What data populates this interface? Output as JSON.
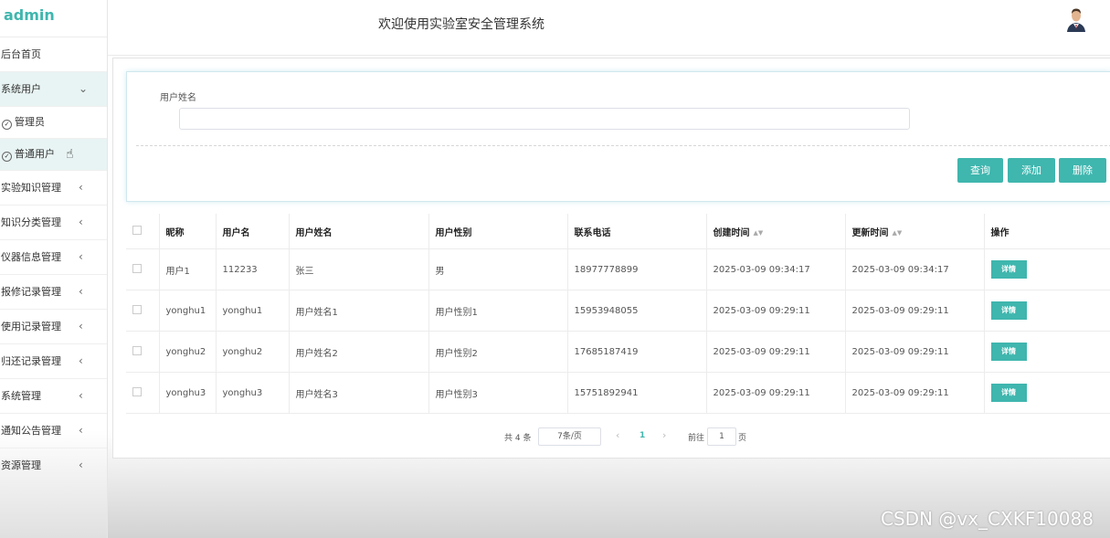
{
  "sidebar": {
    "brand": "admin",
    "items": [
      {
        "label": "后台首页"
      },
      {
        "label": "系统用户",
        "arrow": "⌄"
      },
      {
        "label": "管理员"
      },
      {
        "label": "普通用户"
      },
      {
        "label": "实验知识管理",
        "arrow": "‹"
      },
      {
        "label": "知识分类管理",
        "arrow": "‹"
      },
      {
        "label": "仪器信息管理",
        "arrow": "‹"
      },
      {
        "label": "报修记录管理",
        "arrow": "‹"
      },
      {
        "label": "使用记录管理",
        "arrow": "‹"
      },
      {
        "label": "归还记录管理",
        "arrow": "‹"
      },
      {
        "label": "系统管理",
        "arrow": "‹"
      },
      {
        "label": "通知公告管理",
        "arrow": "‹"
      },
      {
        "label": "资源管理",
        "arrow": "‹"
      }
    ]
  },
  "header": {
    "title": "欢迎使用实验室安全管理系统"
  },
  "search": {
    "field_label": "用户姓名",
    "field_value": "",
    "query_label": "查询",
    "add_label": "添加",
    "delete_label": "删除"
  },
  "table": {
    "headers": [
      "昵称",
      "用户名",
      "用户姓名",
      "用户性别",
      "联系电话",
      "创建时间",
      "更新时间",
      "操作"
    ],
    "rows": [
      {
        "nick": "用户1",
        "username": "112233",
        "name": "张三",
        "gender": "男",
        "phone": "18977778899",
        "created": "2025-03-09 09:34:17",
        "updated": "2025-03-09 09:34:17",
        "action": "详情"
      },
      {
        "nick": "yonghu1",
        "username": "yonghu1",
        "name": "用户姓名1",
        "gender": "用户性别1",
        "phone": "15953948055",
        "created": "2025-03-09 09:29:11",
        "updated": "2025-03-09 09:29:11",
        "action": "详情"
      },
      {
        "nick": "yonghu2",
        "username": "yonghu2",
        "name": "用户姓名2",
        "gender": "用户性别2",
        "phone": "17685187419",
        "created": "2025-03-09 09:29:11",
        "updated": "2025-03-09 09:29:11",
        "action": "详情"
      },
      {
        "nick": "yonghu3",
        "username": "yonghu3",
        "name": "用户姓名3",
        "gender": "用户性别3",
        "phone": "15751892941",
        "created": "2025-03-09 09:29:11",
        "updated": "2025-03-09 09:29:11",
        "action": "详情"
      }
    ]
  },
  "pagination": {
    "total": "共 4 条",
    "page_size": "7条/页",
    "prev": "‹",
    "current": "1",
    "next": "›",
    "goto_prefix": "前往",
    "goto_value": "1",
    "goto_suffix": "页"
  },
  "watermark": "CSDN @vx_CXKF10088",
  "colors": {
    "accent": "#3fb6ae"
  }
}
